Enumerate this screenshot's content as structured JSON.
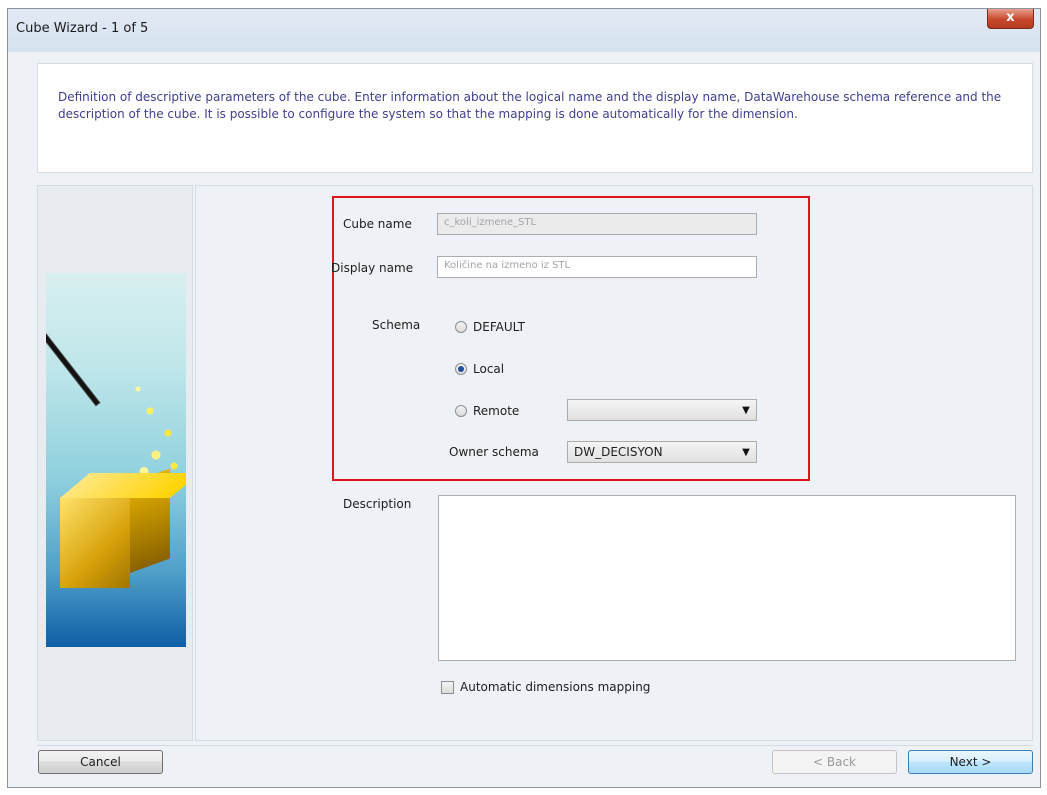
{
  "window": {
    "title": "Cube Wizard - 1 of 5",
    "close_label": "x"
  },
  "description_text": "Definition of descriptive parameters of the cube. Enter information about the logical name and the display name, DataWarehouse schema reference and the description of the cube. It is possible to configure the system so that the mapping is done automatically for the dimension.",
  "form": {
    "cube_name_label": "Cube name",
    "cube_name_value": "c_koli_izmene_STL",
    "display_name_label": "Display name",
    "display_name_value": "Količine na izmeno iz STL",
    "schema_label": "Schema",
    "schema_options": [
      {
        "label": "DEFAULT",
        "selected": false
      },
      {
        "label": "Local",
        "selected": true
      },
      {
        "label": "Remote",
        "selected": false
      }
    ],
    "remote_value": "",
    "owner_schema_label": "Owner schema",
    "owner_schema_value": "DW_DECISYON",
    "description_label": "Description",
    "description_value": "",
    "auto_mapping_label": "Automatic dimensions mapping",
    "auto_mapping_checked": false
  },
  "buttons": {
    "cancel": "Cancel",
    "back": "< Back",
    "next": "Next >"
  },
  "colors": {
    "highlight": "#e0141e",
    "description_text": "#404090"
  }
}
